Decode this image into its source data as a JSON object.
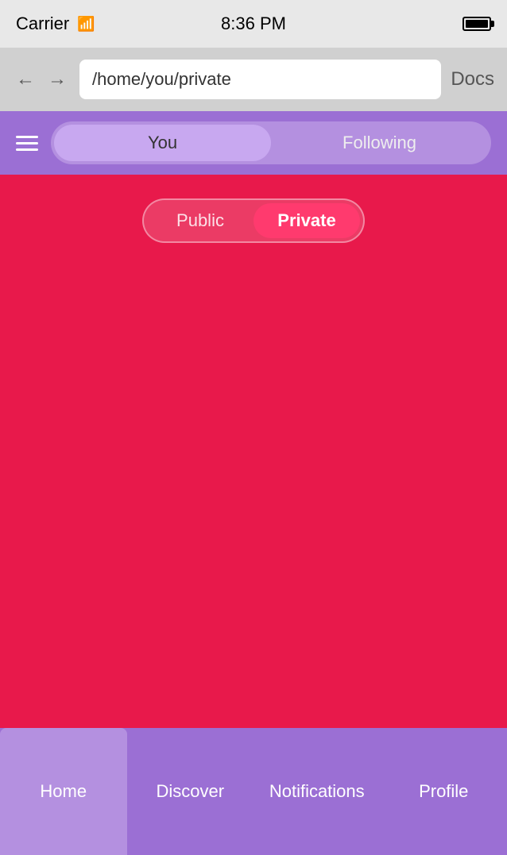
{
  "statusBar": {
    "carrier": "Carrier",
    "time": "8:36 PM"
  },
  "browserBar": {
    "address": "/home/you/private",
    "docsLabel": "Docs"
  },
  "header": {
    "youTabLabel": "You",
    "followingTabLabel": "Following",
    "activeTab": "you"
  },
  "content": {
    "publicLabel": "Public",
    "privateLabel": "Private",
    "activeToggle": "private"
  },
  "bottomNav": {
    "items": [
      {
        "id": "home",
        "label": "Home",
        "active": true
      },
      {
        "id": "discover",
        "label": "Discover",
        "active": false
      },
      {
        "id": "notifications",
        "label": "Notifications",
        "active": false
      },
      {
        "id": "profile",
        "label": "Profile",
        "active": false
      }
    ]
  },
  "colors": {
    "purple": "#9b6fd4",
    "red": "#e8194b",
    "accent": "#ff3a6e"
  }
}
